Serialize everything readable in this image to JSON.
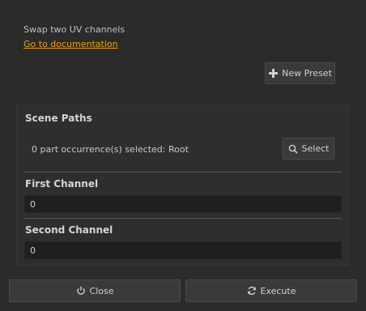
{
  "header": {
    "description": "Swap two UV channels",
    "doc_link": "Go to documentation"
  },
  "presets": {
    "new_preset_label": "New Preset",
    "new_preset_icon": "plus-icon"
  },
  "scene_paths": {
    "title": "Scene Paths",
    "selection_text": "0 part occurrence(s) selected: Root",
    "select_label": "Select",
    "select_icon": "magnifier-icon"
  },
  "first_channel": {
    "title": "First Channel",
    "value": "0"
  },
  "second_channel": {
    "title": "Second Channel",
    "value": "0"
  },
  "footer": {
    "close_label": "Close",
    "close_icon": "power-icon",
    "execute_label": "Execute",
    "execute_icon": "refresh-icon"
  },
  "colors": {
    "background": "#2b2b2b",
    "link": "#f0a30a",
    "field_background": "#1f1f1f",
    "button_background": "#3a3a3a"
  }
}
